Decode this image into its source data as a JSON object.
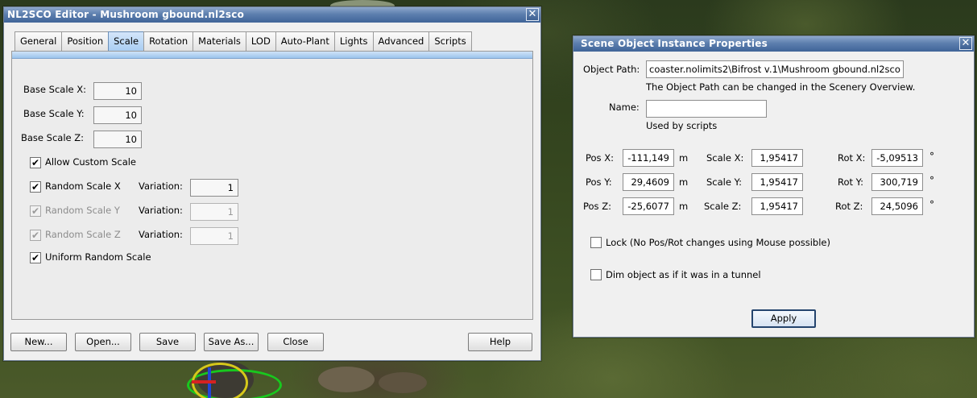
{
  "editor": {
    "title": "NL2SCO Editor - Mushroom gbound.nl2sco",
    "close_glyph": "✕",
    "tabs": [
      "General",
      "Position",
      "Scale",
      "Rotation",
      "Materials",
      "LOD",
      "Auto-Plant",
      "Lights",
      "Advanced",
      "Scripts"
    ],
    "active_tab": "Scale",
    "scale": {
      "base_x_label": "Base Scale X:",
      "base_x_value": "10",
      "base_y_label": "Base Scale Y:",
      "base_y_value": "10",
      "base_z_label": "Base Scale Z:",
      "base_z_value": "10",
      "allow_custom_label": "Allow Custom Scale",
      "allow_custom_checked": true,
      "random_x_label": "Random Scale X",
      "random_x_checked": true,
      "random_y_label": "Random Scale Y",
      "random_y_checked": true,
      "random_z_label": "Random Scale Z",
      "random_z_checked": true,
      "variation_label": "Variation:",
      "variation_x": "1",
      "variation_y": "1",
      "variation_z": "1",
      "uniform_label": "Uniform Random Scale",
      "uniform_checked": true
    },
    "buttons": {
      "new": "New...",
      "open": "Open...",
      "save": "Save",
      "save_as": "Save As...",
      "close": "Close",
      "help": "Help"
    }
  },
  "props": {
    "title": "Scene Object Instance Properties",
    "close_glyph": "✕",
    "object_path_label": "Object Path:",
    "object_path_value": "coaster.nolimits2\\Bifrost v.1\\Mushroom gbound.nl2sco",
    "object_path_hint": "The Object Path can be changed in the Scenery Overview.",
    "name_label": "Name:",
    "name_value": "",
    "name_hint": "Used by scripts",
    "pos_x_label": "Pos X:",
    "pos_x": "-111,149",
    "pos_y_label": "Pos Y:",
    "pos_y": "29,4609",
    "pos_z_label": "Pos Z:",
    "pos_z": "-25,6077",
    "unit_m": "m",
    "scale_x_label": "Scale X:",
    "scale_x": "1,95417",
    "scale_y_label": "Scale Y:",
    "scale_y": "1,95417",
    "scale_z_label": "Scale Z:",
    "scale_z": "1,95417",
    "rot_x_label": "Rot X:",
    "rot_x": "-5,09513",
    "rot_y_label": "Rot Y:",
    "rot_y": "300,719",
    "rot_z_label": "Rot Z:",
    "rot_z": "24,5096",
    "unit_deg": "°",
    "lock_label": "Lock (No Pos/Rot changes using Mouse possible)",
    "lock_checked": false,
    "dim_label": "Dim object as if it was in a tunnel",
    "dim_checked": false,
    "apply_label": "Apply"
  },
  "colors": {
    "titlebar": "#3f6498",
    "active_tab": "#a9cdf2",
    "window_bg": "#f0f0f0"
  }
}
